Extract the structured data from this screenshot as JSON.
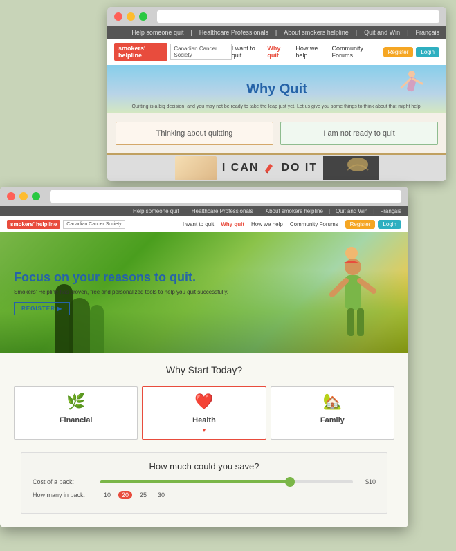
{
  "back_browser": {
    "topnav": {
      "items": [
        "Help someone quit",
        "Healthcare Professionals",
        "About smokers helpline",
        "Quit and Win",
        "Français"
      ]
    },
    "logo": {
      "badge": "smokers' helpline",
      "partner": "Canadian Cancer Society"
    },
    "nav": {
      "links": [
        "I want to quit",
        "Why quit",
        "How we help",
        "Community Forums"
      ],
      "active": "Why quit"
    },
    "buttons": {
      "register": "Register",
      "login": "Login"
    },
    "hero": {
      "title": "Why Quit",
      "subtitle": "Quitting is a big decision, and you may not be ready to take the leap just yet. Let us give you some things to think about that might help."
    },
    "thinking": {
      "box1": "Thinking about quitting",
      "box2": "I am not ready to quit"
    },
    "cando": {
      "text": "I CAN DO IT"
    }
  },
  "front_browser": {
    "topnav": {
      "items": [
        "Help someone quit",
        "Healthcare Professionals",
        "About smokers helpline",
        "Quit and Win",
        "Français"
      ]
    },
    "logo": {
      "badge": "smokers' helpline",
      "partner": "Canadian Cancer Society"
    },
    "nav": {
      "links": [
        "I want to quit",
        "Why quit",
        "How we help",
        "Community Forums"
      ],
      "active": "Why quit"
    },
    "buttons": {
      "register": "Register",
      "login": "Login"
    },
    "hero": {
      "title": "Focus on your reasons to quit.",
      "subtitle": "Smokers' Helpline has proven, free and personalized tools to help you quit successfully.",
      "register_btn": "REGISTER ▶"
    },
    "why_start": {
      "title": "Why Start Today?",
      "cards": [
        {
          "icon": "🌿",
          "label": "Financial",
          "active": false
        },
        {
          "icon": "❤️",
          "label": "Health",
          "active": true,
          "arrow": "▼"
        },
        {
          "icon": "🏠",
          "label": "Family",
          "active": false
        }
      ]
    },
    "how_much": {
      "title": "How much could you save?",
      "cost_label": "Cost of a pack:",
      "cost_min": "",
      "cost_max": "$10",
      "cost_value": "$10",
      "cost_percent": 75,
      "pack_label": "How many in pack:",
      "pack_options": [
        "10",
        "20",
        "25",
        "30"
      ],
      "pack_active": "20"
    }
  }
}
